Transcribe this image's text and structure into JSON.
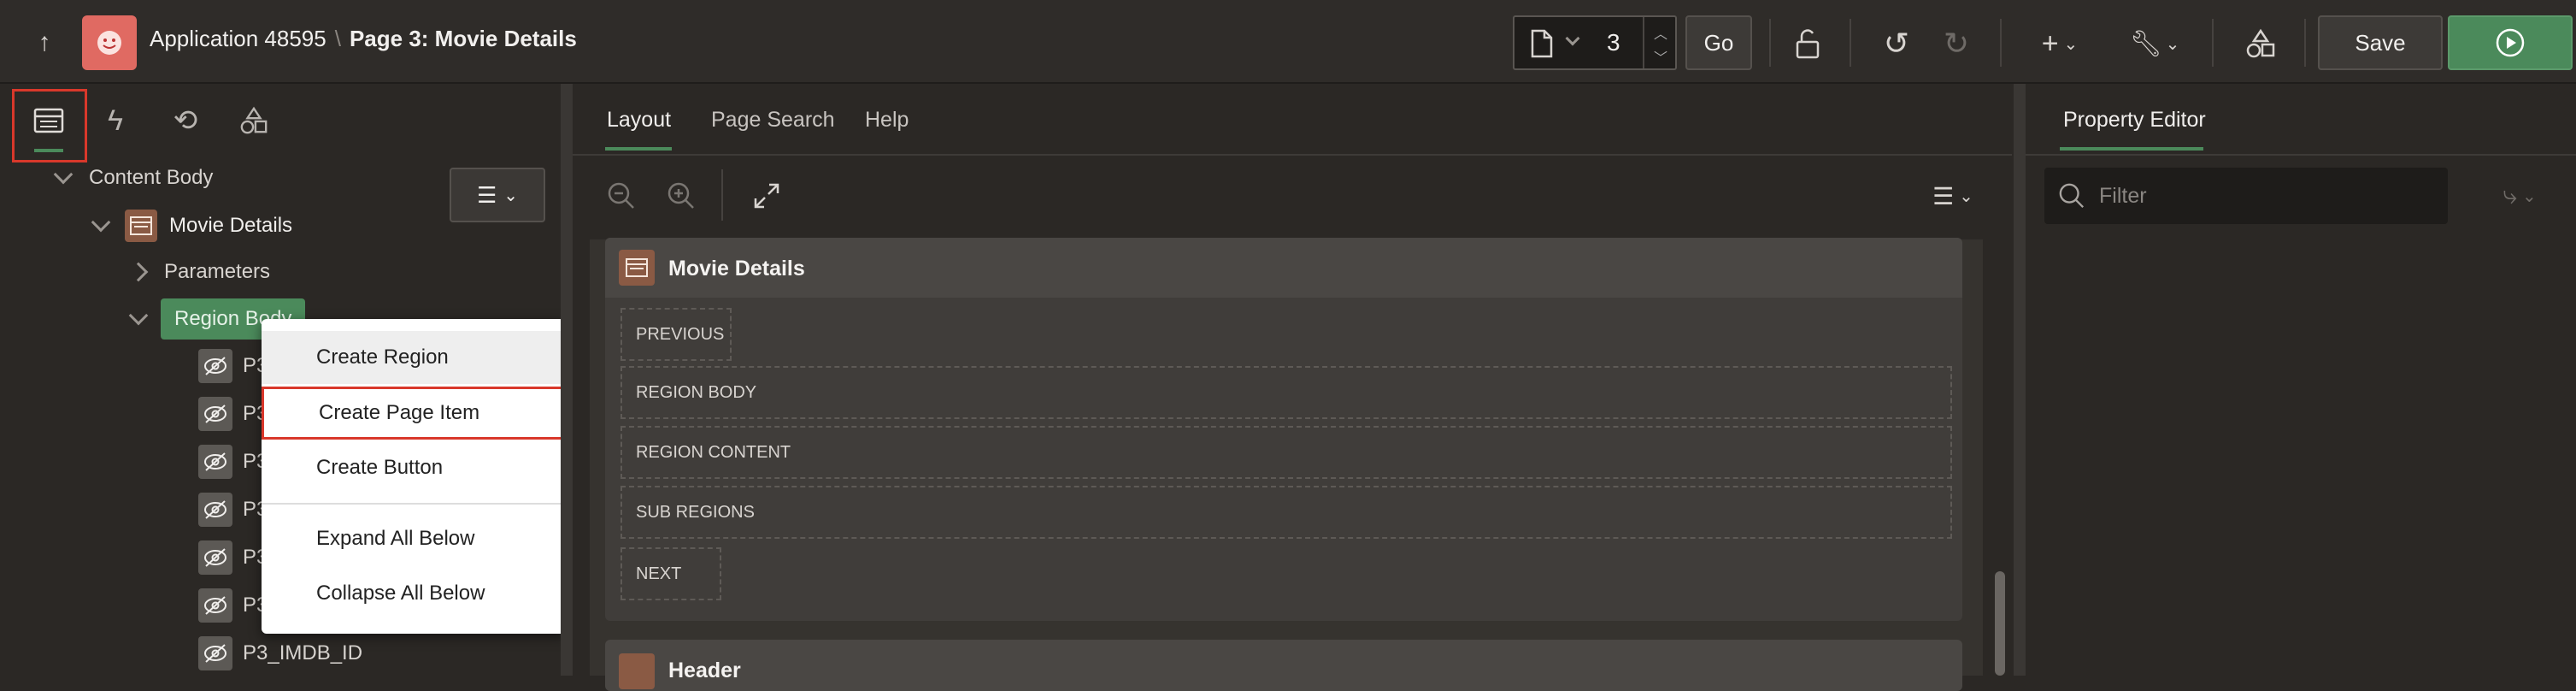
{
  "header": {
    "app_name": "Application 48595",
    "page_title": "Page 3: Movie Details",
    "page_number": "3",
    "go_label": "Go",
    "save_label": "Save"
  },
  "tree": {
    "content_body": "Content Body",
    "movie_details": "Movie Details",
    "parameters": "Parameters",
    "region_body": "Region Body",
    "items": [
      "P3",
      "P3",
      "P3",
      "P3",
      "P3",
      "P3",
      "P3_IMDB_ID"
    ]
  },
  "context_menu": {
    "items": [
      "Create Region",
      "Create Page Item",
      "Create Button",
      "Expand All Below",
      "Collapse All Below"
    ]
  },
  "center": {
    "tabs": [
      "Layout",
      "Page Search",
      "Help"
    ],
    "region_title": "Movie Details",
    "slots": [
      "PREVIOUS",
      "REGION BODY",
      "REGION CONTENT",
      "SUB REGIONS",
      "NEXT"
    ],
    "second_region_title": "Header"
  },
  "right": {
    "tab": "Property Editor",
    "filter_placeholder": "Filter"
  },
  "colors": {
    "accent_green": "#4b8a5b",
    "highlight_red": "#d9382b",
    "app_icon": "#e06a62"
  }
}
